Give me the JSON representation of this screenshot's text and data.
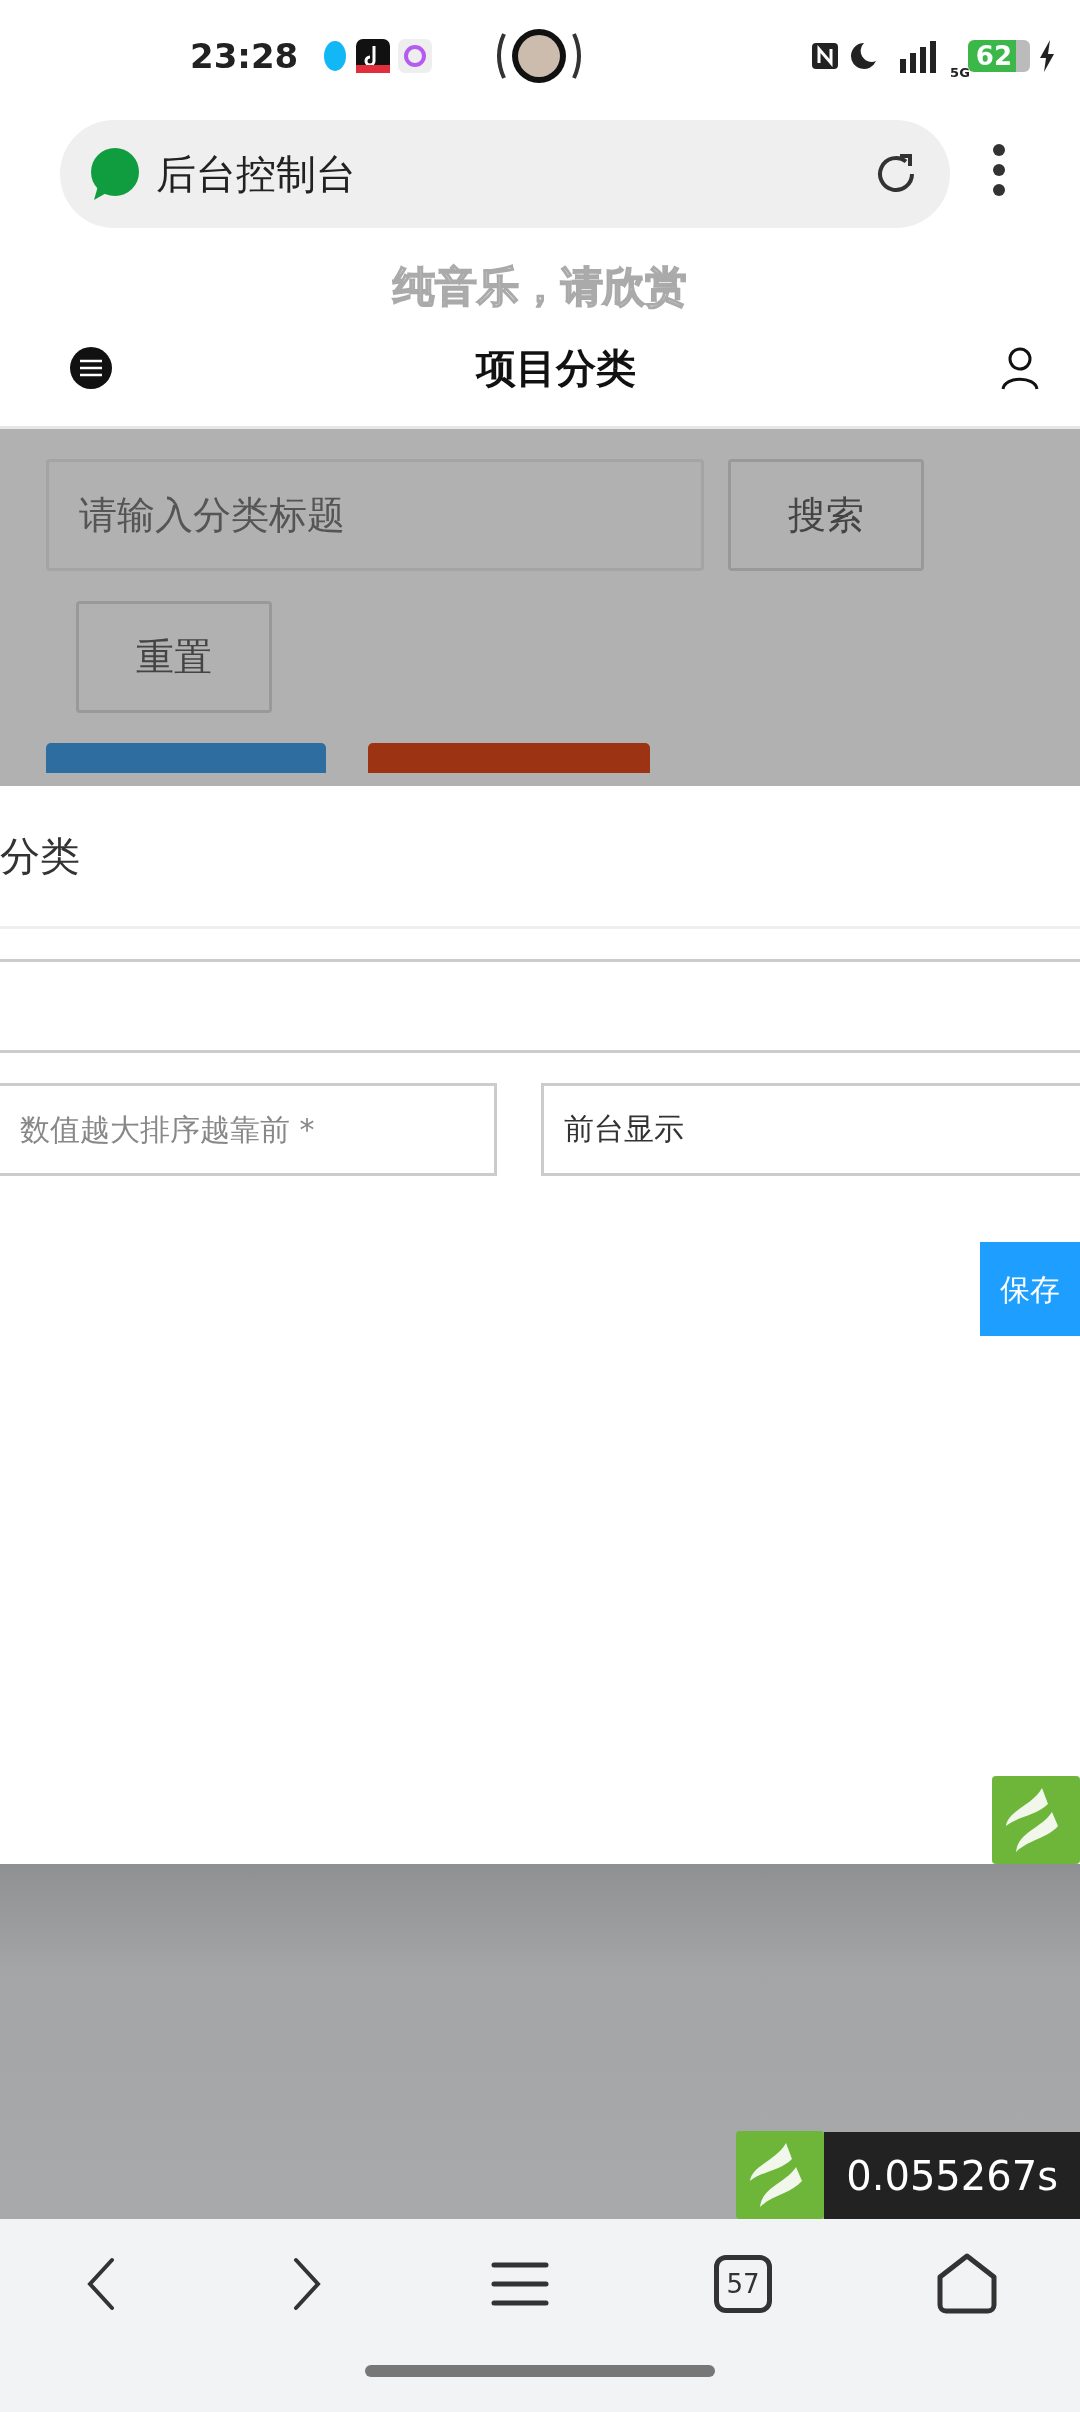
{
  "status_bar": {
    "time": "23:28",
    "battery": "62",
    "network": "5G"
  },
  "browser": {
    "address": "后台控制台",
    "tab_count": "57"
  },
  "lyrics_overlay": "纯音乐，请欣赏",
  "header": {
    "title": "项目分类"
  },
  "search": {
    "placeholder": "请输入分类标题",
    "buttons": [
      "搜索",
      "重置"
    ]
  },
  "modal": {
    "title": "分类",
    "sort_placeholder": "数值越大排序越靠前 *",
    "display_value": "前台显示",
    "save_button": "保存"
  },
  "timer": "0.055267s"
}
